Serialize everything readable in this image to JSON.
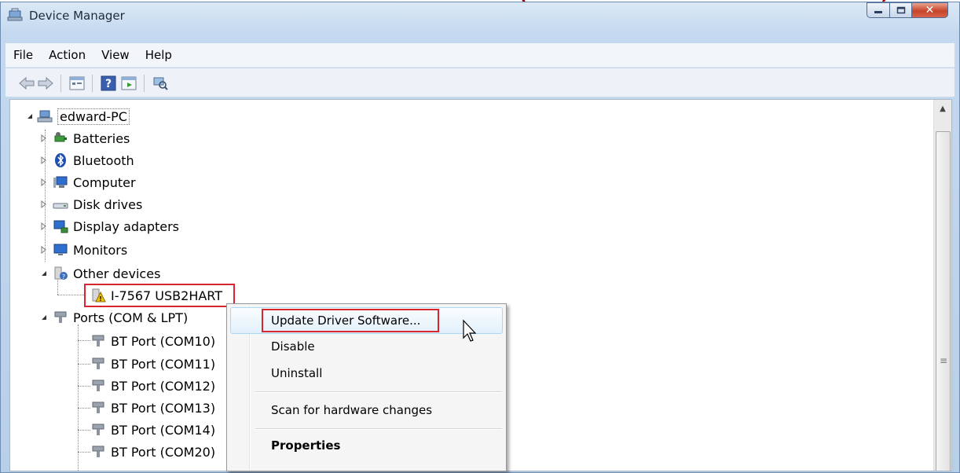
{
  "window": {
    "title": "Device Manager"
  },
  "menubar": {
    "items": [
      "File",
      "Action",
      "View",
      "Help"
    ]
  },
  "toolbar": {
    "icons": [
      "back-icon",
      "forward-icon",
      "properties-icon",
      "help-icon",
      "update-icon",
      "scan-icon"
    ]
  },
  "tree": {
    "root": "edward-PC",
    "categories": [
      "Batteries",
      "Bluetooth",
      "Computer",
      "Disk drives",
      "Display adapters",
      "Monitors",
      "Other devices"
    ],
    "other_devices_child": "I-7567 USB2HART",
    "ports_label": "Ports (COM & LPT)",
    "ports": [
      "BT Port (COM10)",
      "BT Port (COM11)",
      "BT Port (COM12)",
      "BT Port (COM13)",
      "BT Port (COM14)",
      "BT Port (COM20)"
    ]
  },
  "context_menu": {
    "items": [
      "Update Driver Software...",
      "Disable",
      "Uninstall",
      "Scan for hardware changes",
      "Properties"
    ]
  },
  "colors": {
    "highlight_box": "#d9252f",
    "menu_highlight": "#e2f0fb",
    "window_frame": "#c4d9ef"
  }
}
